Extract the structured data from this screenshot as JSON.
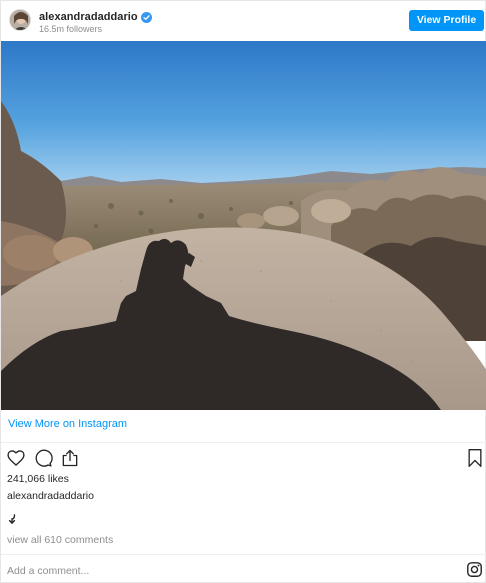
{
  "header": {
    "username": "alexandradaddario",
    "followers": "16.5m followers",
    "view_profile_label": "View Profile",
    "verified_icon": "verified-badge-icon",
    "avatar_icon": "profile-avatar"
  },
  "post": {
    "image_icon": "landscape-photo",
    "view_more_label": "View More on Instagram",
    "likes": "241,066 likes",
    "caption_username": "alexandradaddario",
    "caption_emoji": "arrow-curve-down-icon",
    "view_comments": "view all 610 comments",
    "add_comment_placeholder": "Add a comment..."
  },
  "actions": [
    "heart-icon",
    "comment-icon",
    "share-icon",
    "bookmark-icon",
    "instagram-logo-icon"
  ],
  "colors": {
    "accent": "#0095f6",
    "text": "#262626",
    "muted": "#8e8e8e",
    "divider": "#efefef"
  }
}
